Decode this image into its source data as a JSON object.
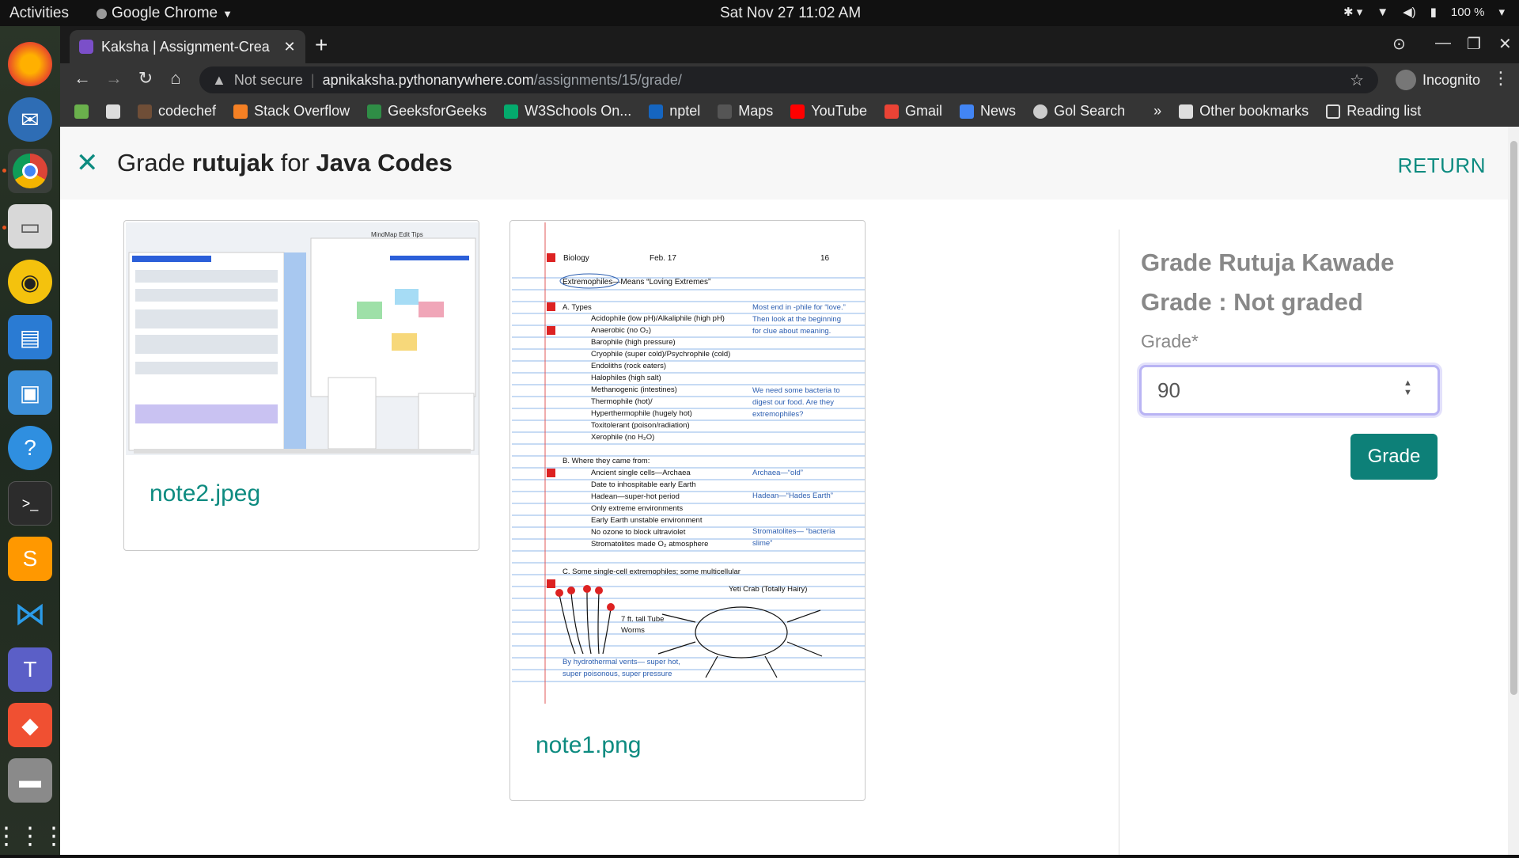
{
  "topbar": {
    "activities": "Activities",
    "app_name": "Google Chrome",
    "clock": "Sat Nov 27  11:02 AM",
    "battery": "100 %"
  },
  "dock": {
    "items": [
      "firefox-icon",
      "mail-icon",
      "chrome-icon",
      "files-icon",
      "rhythmbox-icon",
      "writer-icon",
      "software-icon",
      "help-icon",
      "terminal-icon",
      "sublime-icon",
      "vscode-icon",
      "teams-icon",
      "git-icon",
      "drive-icon",
      "apps-grid-icon"
    ]
  },
  "chrome": {
    "tab_title": "Kaksha | Assignment-Crea",
    "omnibox": {
      "security": "Not secure",
      "host": "apnikaksha.pythonanywhere.com",
      "path": "/assignments/15/grade/"
    },
    "incognito": "Incognito",
    "bookmarks": [
      "codechef",
      "Stack Overflow",
      "GeeksforGeeks",
      "W3Schools On...",
      "nptel",
      "Maps",
      "YouTube",
      "Gmail",
      "News",
      "Gol Search"
    ],
    "more_bookmarks": "»",
    "other_bookmarks": "Other bookmarks",
    "reading_list": "Reading list"
  },
  "page": {
    "title_prefix": "Grade ",
    "student": "rutujak",
    "title_mid": " for ",
    "assignment": "Java Codes",
    "return_label": "RETURN",
    "files": [
      {
        "name": "note2.jpeg"
      },
      {
        "name": "note1.png"
      }
    ],
    "note1": {
      "header_left": "Biology",
      "header_date": "Feb. 17",
      "header_page": "16",
      "title": "Extremophiles—Means “Loving Extremes”",
      "section_a": "A. Types",
      "types": [
        "Acidophile (low pH)/Alkaliphile (high pH)",
        "Anaerobic (no O₂)",
        "Barophile (high pressure)",
        "Cryophile (super cold)/Psychrophile (cold)",
        "Endoliths (rock eaters)",
        "Halophiles (high salt)",
        "Methanogenic (intestines)",
        "Thermophile (hot)/",
        "Hyperthermophile (hugely hot)",
        "Toxitolerant (poison/radiation)",
        "Xerophile (no H₂O)"
      ],
      "note_a1": "Most end in -phile for “love.” Then look at the beginning for clue about meaning.",
      "note_a2": "We need some bacteria to digest our food. Are they extremophiles?",
      "section_b": "B. Where they came from:",
      "origins": [
        "Ancient single cells—Archaea",
        "Date to inhospitable early Earth",
        "Hadean—super-hot period",
        "Only extreme environments",
        "Early Earth unstable environment",
        "No ozone to block ultraviolet",
        "Stromatolites made O₂ atmosphere"
      ],
      "note_b1": "Archaea—“old”",
      "note_b2": "Hadean—“Hades Earth”",
      "note_b3": "Stromatolites— “bacteria slime”",
      "section_c": "C. Some single-cell extremophiles; some multicellular",
      "crab": "Yeti Crab (Totally Hairy)",
      "worms": "7 ft. tall Tube Worms",
      "vents": "By hydrothermal vents— super hot, super poisonous, super pressure"
    },
    "note2": {
      "title": "MindMap Edit Tips"
    },
    "grade_panel": {
      "heading": "Grade Rutuja Kawade",
      "status": "Grade : Not graded",
      "label": "Grade*",
      "value": "90",
      "button": "Grade"
    }
  }
}
